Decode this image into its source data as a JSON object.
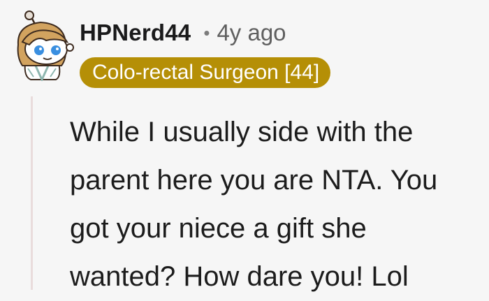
{
  "comment": {
    "username": "HPNerd44",
    "separator": "•",
    "timestamp": "4y ago",
    "flair": "Colo-rectal Surgeon [44]",
    "body": "While I usually side with the\nparent here you are NTA. You\ngot your niece a gift she\nwanted? How dare you! Lol"
  },
  "colors": {
    "background": "#f6f6f6",
    "flair_bg": "#b58f06",
    "flair_text": "#ffffff",
    "username": "#1a1a1b",
    "meta": "#5f5f5f",
    "thread_line": "#e9dcdc"
  },
  "icons": {
    "avatar": "snoo-avatar-icon"
  }
}
